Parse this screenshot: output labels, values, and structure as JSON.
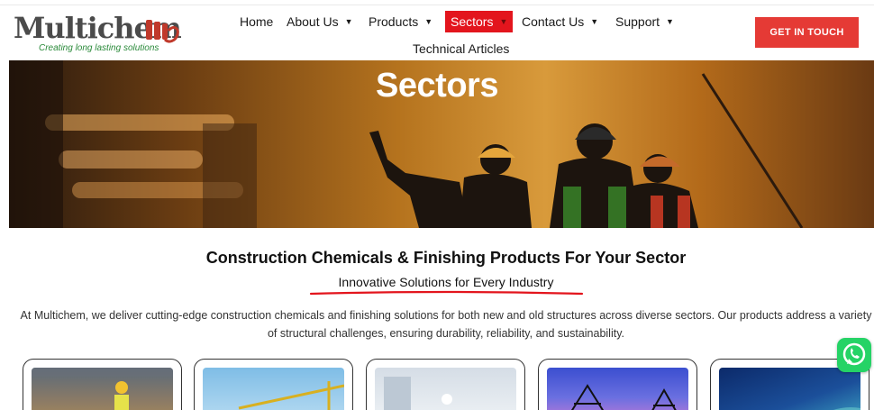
{
  "header": {
    "logo": {
      "name": "Multichem",
      "tagline": "Creating long lasting solutions"
    },
    "nav": [
      {
        "label": "Home",
        "has_dropdown": false
      },
      {
        "label": "About Us",
        "has_dropdown": true
      },
      {
        "label": "Products",
        "has_dropdown": true
      },
      {
        "label": "Sectors",
        "has_dropdown": true,
        "active": true
      },
      {
        "label": "Contact Us",
        "has_dropdown": true
      },
      {
        "label": "Support",
        "has_dropdown": true
      },
      {
        "label": "Technical Articles",
        "has_dropdown": false
      }
    ],
    "cta_label": "GET IN TOUCH"
  },
  "hero": {
    "title": "Sectors"
  },
  "intro": {
    "heading": "Construction Chemicals & Finishing Products For Your Sector",
    "subheading": "Innovative Solutions for Every Industry",
    "paragraph": "At Multichem, we deliver cutting-edge construction chemicals and finishing solutions for both new and old structures across diverse sectors. Our products address a variety of structural challenges, ensuring durability, reliability, and sustainability."
  },
  "colors": {
    "brand_red": "#e3151d",
    "cta_red": "#e53a35",
    "whatsapp_green": "#25d366"
  },
  "icons": {
    "dropdown": "chevron-down-icon",
    "chat": "whatsapp-icon"
  }
}
